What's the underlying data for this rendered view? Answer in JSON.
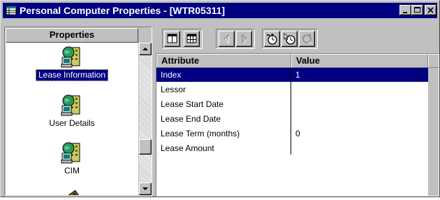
{
  "window": {
    "title": "Personal Computer Properties - [WTR05311]"
  },
  "left_pane": {
    "header": "Properties",
    "items": [
      {
        "label": "Lease Information",
        "selected": true
      },
      {
        "label": "User Details",
        "selected": false
      },
      {
        "label": "CIM",
        "selected": false
      }
    ]
  },
  "grid": {
    "columns": [
      "Attribute",
      "Value"
    ],
    "rows": [
      {
        "attribute": "Index",
        "value": "1",
        "selected": true
      },
      {
        "attribute": "Lessor",
        "value": ""
      },
      {
        "attribute": "Lease Start Date",
        "value": ""
      },
      {
        "attribute": "Lease End Date",
        "value": ""
      },
      {
        "attribute": "Lease Term (months)",
        "value": "0"
      },
      {
        "attribute": "Lease Amount",
        "value": ""
      }
    ]
  },
  "colors": {
    "title_bar": "#000080",
    "selection": "#000080",
    "face": "#c0c0c0"
  },
  "icons": {
    "app": "grid-app-icon",
    "toolbar": [
      "list-view-icon",
      "grid-view-icon",
      "previous-icon",
      "next-icon",
      "stopwatch-icon",
      "clock-cursor-icon",
      "refresh-icon"
    ]
  }
}
